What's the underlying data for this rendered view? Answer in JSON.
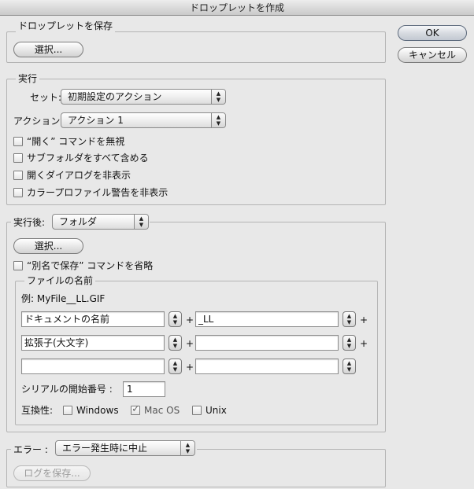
{
  "window": {
    "title": "ドロップレットを作成"
  },
  "dialog_buttons": {
    "ok": "OK",
    "cancel": "キャンセル"
  },
  "save_droplet": {
    "legend": "ドロップレットを保存",
    "choose": "選択..."
  },
  "play": {
    "legend": "実行",
    "set_label": "セット:",
    "set_value": "初期設定のアクション",
    "action_label": "アクション:",
    "action_value": "アクション 1",
    "options": [
      "“開く” コマンドを無視",
      "サブフォルダをすべて含める",
      "開くダイアログを非表示",
      "カラープロファイル警告を非表示"
    ]
  },
  "destination": {
    "label": "実行後:",
    "value": "フォルダ",
    "choose": "選択...",
    "override_save_as": "“別名で保存” コマンドを省略"
  },
  "file_naming": {
    "legend": "ファイルの名前",
    "example": "例: MyFile__LL.GIF",
    "plus": "+",
    "fields": [
      [
        "ドキュメントの名前",
        "_LL"
      ],
      [
        "拡張子(大文字)",
        ""
      ],
      [
        "",
        ""
      ]
    ],
    "serial_label": "シリアルの開始番号 :",
    "serial_value": "1",
    "compat_label": "互換性:",
    "compat": [
      {
        "label": "Windows",
        "checked": false
      },
      {
        "label": "Mac OS",
        "checked": true
      },
      {
        "label": "Unix",
        "checked": false
      }
    ]
  },
  "errors": {
    "label": "エラー :",
    "value": "エラー発生時に中止",
    "save_log": "ログを保存..."
  },
  "icons": {
    "select_arrows": "up-down-arrows-icon",
    "checkbox_check": "checkmark-icon"
  },
  "colors": {
    "window_bg": "#e8e8e8",
    "border": "#b4b4b4"
  }
}
